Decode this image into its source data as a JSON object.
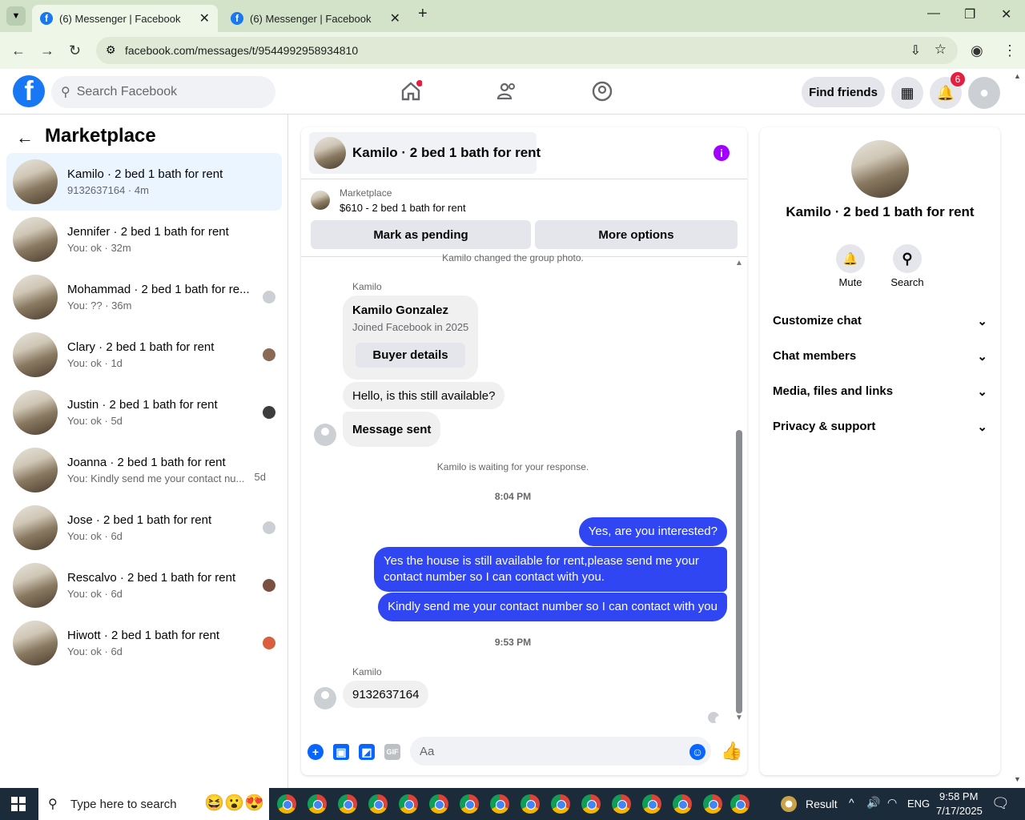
{
  "browser": {
    "tabs": [
      {
        "title": "(6) Messenger | Facebook"
      },
      {
        "title": "(6) Messenger | Facebook"
      }
    ],
    "url": "facebook.com/messages/t/9544992958934810"
  },
  "fb": {
    "search_placeholder": "Search Facebook",
    "find_friends": "Find friends",
    "notification_count": "6"
  },
  "sidebar": {
    "title": "Marketplace",
    "conversations": [
      {
        "name": "Kamilo · 2 bed 1 bath for rent",
        "sub": "9132637164 · 4m"
      },
      {
        "name": "Jennifer · 2 bed 1 bath for rent",
        "sub": "You: ok · 32m"
      },
      {
        "name": "Mohammad · 2 bed 1 bath for re...",
        "sub": "You: ?? · 36m"
      },
      {
        "name": "Clary · 2 bed 1 bath for rent",
        "sub": "You: ok · 1d"
      },
      {
        "name": "Justin · 2 bed 1 bath for rent",
        "sub": "You: ok · 5d"
      },
      {
        "name": "Joanna · 2 bed 1 bath for rent",
        "sub": "You: Kindly send me your contact nu...",
        "time": "5d"
      },
      {
        "name": "Jose · 2 bed 1 bath for rent",
        "sub": "You: ok · 6d"
      },
      {
        "name": "Rescalvo · 2 bed 1 bath for rent",
        "sub": "You: ok · 6d"
      },
      {
        "name": "Hiwott · 2 bed 1 bath for rent",
        "sub": "You: ok · 6d"
      }
    ]
  },
  "chat": {
    "title": "Kamilo · 2 bed 1 bath for rent",
    "marketplace": {
      "label": "Marketplace",
      "listing": "$610 - 2 bed 1 bath for rent",
      "mark_pending": "Mark as pending",
      "more_options": "More options"
    },
    "sys_photo": "Kamilo changed the group photo.",
    "sender": "Kamilo",
    "profile_card": {
      "name": "Kamilo Gonzalez",
      "joined": "Joined Facebook in 2025",
      "button": "Buyer details"
    },
    "msg1": "Hello, is this still available?",
    "msg2": "Message sent",
    "sys_waiting": "Kamilo is waiting for your response.",
    "time1": "8:04 PM",
    "out1": "Yes, are you interested?",
    "out2": "Yes the house is still available for rent,please send me your contact number so I can contact with you.",
    "out3": "Kindly send me your contact number so I can contact with you",
    "time2": "9:53 PM",
    "msg3": "9132637164",
    "composer_placeholder": "Aa"
  },
  "details": {
    "name": "Kamilo · 2 bed 1 bath for rent",
    "mute": "Mute",
    "search": "Search",
    "sections": [
      "Customize chat",
      "Chat members",
      "Media, files and links",
      "Privacy & support"
    ]
  },
  "taskbar": {
    "search_placeholder": "Type here to search",
    "result": "Result",
    "lang": "ENG",
    "time": "9:58 PM",
    "date": "7/17/2025"
  }
}
